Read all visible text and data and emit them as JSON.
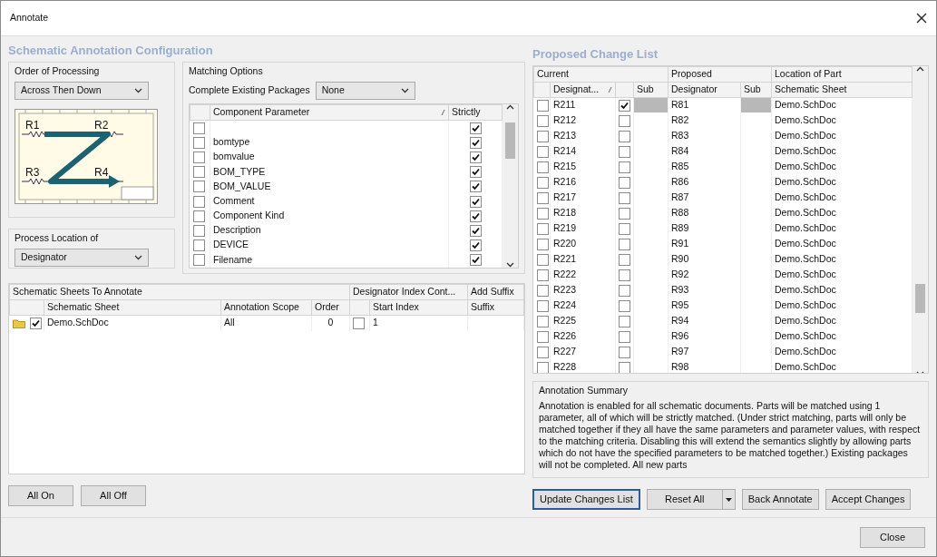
{
  "window": {
    "title": "Annotate"
  },
  "config": {
    "heading": "Schematic Annotation Configuration",
    "order": {
      "label": "Order of Processing",
      "value": "Across Then Down",
      "diagram_labels": [
        "R1",
        "R2",
        "R3",
        "R4"
      ]
    },
    "location": {
      "label": "Process Location of",
      "value": "Designator"
    },
    "matching": {
      "label": "Matching Options",
      "packages_label": "Complete Existing Packages",
      "packages_value": "None",
      "columns": [
        "Component Parameter",
        "Strictly"
      ],
      "rows": [
        {
          "checked": false,
          "strictly": true
        },
        {
          "name": "bomtype",
          "checked": false,
          "strictly": true
        },
        {
          "name": "bomvalue",
          "checked": false,
          "strictly": true
        },
        {
          "name": "BOM_TYPE",
          "checked": false,
          "strictly": true
        },
        {
          "name": "BOM_VALUE",
          "checked": false,
          "strictly": true
        },
        {
          "name": "Comment",
          "checked": false,
          "strictly": true
        },
        {
          "name": "Component Kind",
          "checked": false,
          "strictly": true
        },
        {
          "name": "Description",
          "checked": false,
          "strictly": true
        },
        {
          "name": "DEVICE",
          "checked": false,
          "strictly": true
        },
        {
          "name": "Filename",
          "checked": false,
          "strictly": true
        }
      ]
    }
  },
  "sheets": {
    "title": "Schematic Sheets To Annotate",
    "group_headers": [
      "Designator Index Cont...",
      "Add Suffix"
    ],
    "columns": [
      "Schematic Sheet",
      "Annotation Scope",
      "Order",
      "Start Index",
      "Suffix"
    ],
    "rows": [
      {
        "sheet": "Demo.SchDoc",
        "checked": true,
        "scope": "All",
        "order": "0",
        "index_enabled": false,
        "start_index": "1"
      }
    ]
  },
  "left_buttons": [
    "All On",
    "All Off"
  ],
  "changes": {
    "heading": "Proposed Change List",
    "groups": [
      "Current",
      "Proposed",
      "Location of Part"
    ],
    "columns": [
      "Designat...",
      "Sub",
      "Designator",
      "Sub",
      "Schematic Sheet"
    ],
    "rows": [
      {
        "current": "R211",
        "checked": false,
        "sub_checked": true,
        "selected": true,
        "proposed": "R81",
        "sheet": "Demo.SchDoc"
      },
      {
        "current": "R212",
        "checked": false,
        "sub_checked": false,
        "selected": false,
        "proposed": "R82",
        "sheet": "Demo.SchDoc"
      },
      {
        "current": "R213",
        "checked": false,
        "sub_checked": false,
        "selected": false,
        "proposed": "R83",
        "sheet": "Demo.SchDoc"
      },
      {
        "current": "R214",
        "checked": false,
        "sub_checked": false,
        "selected": false,
        "proposed": "R84",
        "sheet": "Demo.SchDoc"
      },
      {
        "current": "R215",
        "checked": false,
        "sub_checked": false,
        "selected": false,
        "proposed": "R85",
        "sheet": "Demo.SchDoc"
      },
      {
        "current": "R216",
        "checked": false,
        "sub_checked": false,
        "selected": false,
        "proposed": "R86",
        "sheet": "Demo.SchDoc"
      },
      {
        "current": "R217",
        "checked": false,
        "sub_checked": false,
        "selected": false,
        "proposed": "R87",
        "sheet": "Demo.SchDoc"
      },
      {
        "current": "R218",
        "checked": false,
        "sub_checked": false,
        "selected": false,
        "proposed": "R88",
        "sheet": "Demo.SchDoc"
      },
      {
        "current": "R219",
        "checked": false,
        "sub_checked": false,
        "selected": false,
        "proposed": "R89",
        "sheet": "Demo.SchDoc"
      },
      {
        "current": "R220",
        "checked": false,
        "sub_checked": false,
        "selected": false,
        "proposed": "R91",
        "sheet": "Demo.SchDoc"
      },
      {
        "current": "R221",
        "checked": false,
        "sub_checked": false,
        "selected": false,
        "proposed": "R90",
        "sheet": "Demo.SchDoc"
      },
      {
        "current": "R222",
        "checked": false,
        "sub_checked": false,
        "selected": false,
        "proposed": "R92",
        "sheet": "Demo.SchDoc"
      },
      {
        "current": "R223",
        "checked": false,
        "sub_checked": false,
        "selected": false,
        "proposed": "R93",
        "sheet": "Demo.SchDoc"
      },
      {
        "current": "R224",
        "checked": false,
        "sub_checked": false,
        "selected": false,
        "proposed": "R95",
        "sheet": "Demo.SchDoc"
      },
      {
        "current": "R225",
        "checked": false,
        "sub_checked": false,
        "selected": false,
        "proposed": "R94",
        "sheet": "Demo.SchDoc"
      },
      {
        "current": "R226",
        "checked": false,
        "sub_checked": false,
        "selected": false,
        "proposed": "R96",
        "sheet": "Demo.SchDoc"
      },
      {
        "current": "R227",
        "checked": false,
        "sub_checked": false,
        "selected": false,
        "proposed": "R97",
        "sheet": "Demo.SchDoc"
      },
      {
        "current": "R228",
        "checked": false,
        "sub_checked": false,
        "selected": false,
        "proposed": "R98",
        "sheet": "Demo.SchDoc"
      }
    ]
  },
  "summary": {
    "label": "Annotation Summary",
    "text": "Annotation is enabled for all schematic documents. Parts will be matched using 1 parameter, all of which will be strictly matched. (Under strict matching, parts will only be matched together if they all have the same parameters and parameter values, with respect to the matching criteria. Disabling this will extend the semantics slightly by allowing parts which do not have the specified parameters to be matched together.) Existing packages will not be completed. All new parts"
  },
  "right_buttons": [
    {
      "label": "Update Changes List",
      "kind": "default"
    },
    {
      "label": "Reset All",
      "kind": "split"
    },
    {
      "label": "Back Annotate",
      "kind": "plain"
    },
    {
      "label": "Accept Changes",
      "kind": "plain"
    }
  ],
  "footer": {
    "close": "Close"
  }
}
